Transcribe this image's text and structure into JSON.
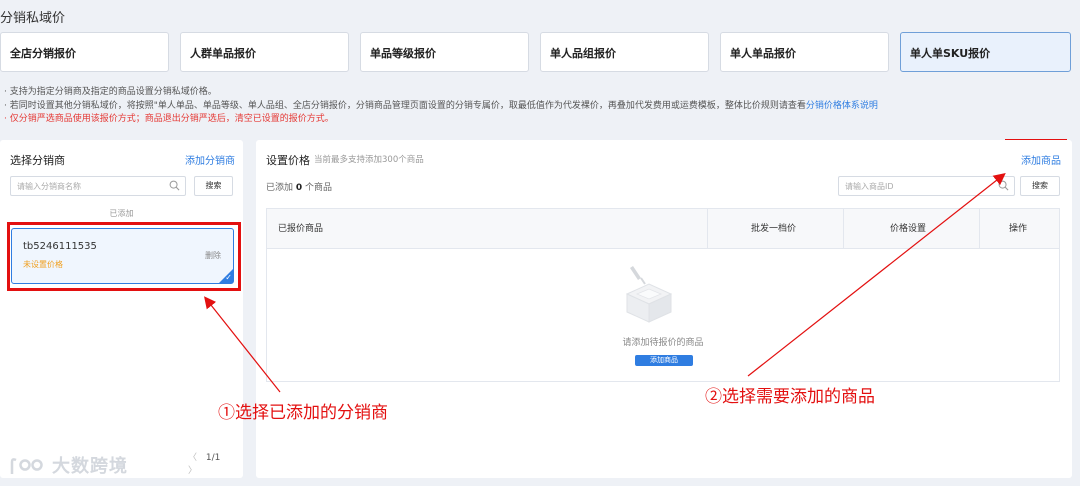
{
  "page": {
    "title": "分销私域价"
  },
  "tabs": [
    {
      "label": "全店分销报价"
    },
    {
      "label": "人群单品报价"
    },
    {
      "label": "单品等级报价"
    },
    {
      "label": "单人品组报价"
    },
    {
      "label": "单人单品报价"
    },
    {
      "label": "单人单SKU报价",
      "active": true
    }
  ],
  "notes": {
    "line1": "· 支持为指定分销商及指定的商品设置分销私域价格。",
    "line2_prefix": "· 若同时设置其他分销私域价，将按照\"单人单品、单品等级、单人品组、全店分销报价，分销商品管理页面设置的分销专属价，取最低值作为代发裸价，再叠加代发费用或运费模板，整体比价规则请查看",
    "line2_link": "分销价格体系说明",
    "line3_warning": "· 仅分销严选商品使用该报价方式；商品退出分销严选后，清空已设置的报价方式。"
  },
  "left_panel": {
    "title": "选择分销商",
    "add_link": "添加分销商",
    "search_placeholder": "请输入分销商名称",
    "search_button": "搜索",
    "added_label": "已添加",
    "distributor": {
      "name": "tb5246111535",
      "status": "未设置价格",
      "delete_label": "删除"
    },
    "pager": {
      "prev": "〈",
      "page": "1/1",
      "next": "〉"
    }
  },
  "right_panel": {
    "title": "设置价格",
    "subtitle": "当前最多支持添加300个商品",
    "add_link": "添加商品",
    "added_prefix": "已添加",
    "added_count": "0",
    "added_suffix": "个商品",
    "search_placeholder": "请输入商品ID",
    "search_button": "搜索",
    "table": {
      "headers": [
        "已报价商品",
        "批发一档价",
        "价格设置",
        "操作"
      ],
      "empty_text": "请添加待报价的商品",
      "empty_button": "添加商品"
    }
  },
  "annotations": {
    "step1": "①选择已添加的分销商",
    "step2": "②选择需要添加的商品"
  },
  "watermark": {
    "text": "大数跨境"
  },
  "colors": {
    "accent": "#2f7de1",
    "annotation_red": "#e31010",
    "status_orange": "#f0a020",
    "warning_red": "#e53935"
  },
  "icons": {
    "search": "search-icon",
    "check": "check-icon",
    "empty_box": "empty-box-illustration"
  }
}
